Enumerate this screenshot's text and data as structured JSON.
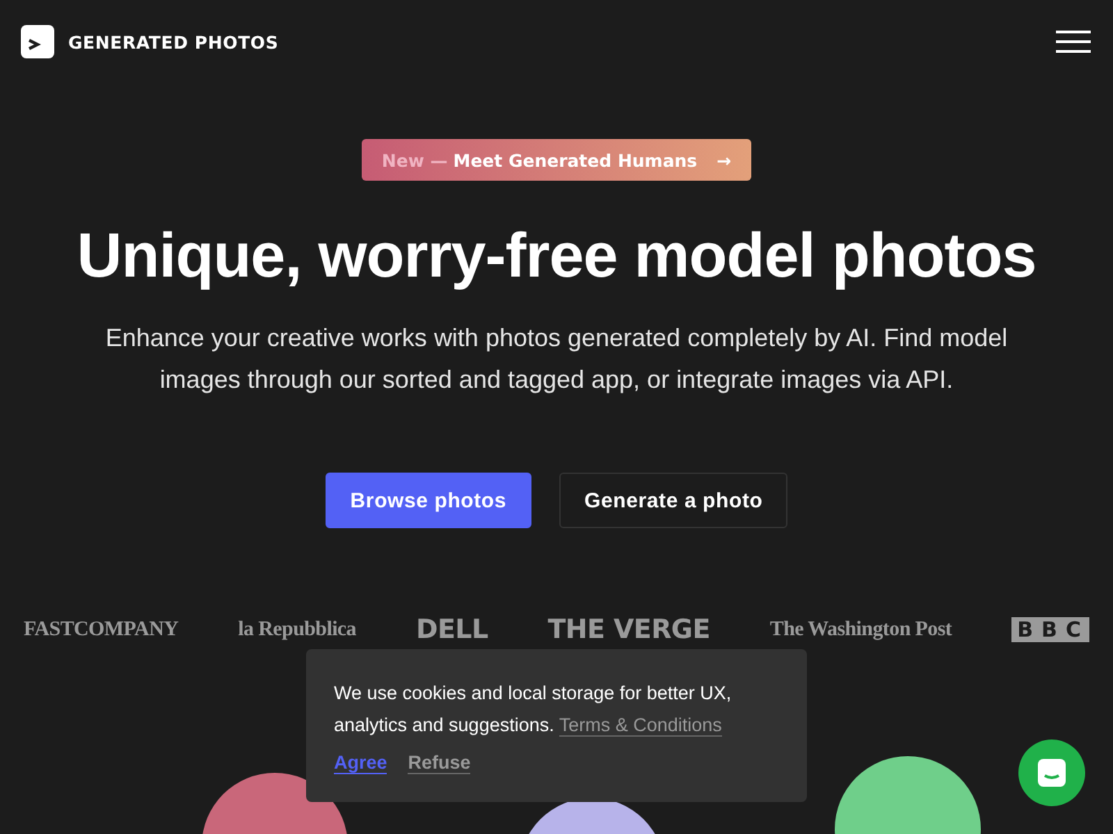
{
  "header": {
    "brand": "GENERATED PHOTOS"
  },
  "announcement": {
    "tag": "New —",
    "text": "Meet Generated Humans",
    "arrow": "→"
  },
  "hero": {
    "title": "Unique, worry-free model photos",
    "subtitle": "Enhance your creative works with photos generated completely by AI. Find model images through our sorted and tagged app, or integrate images via API."
  },
  "buttons": [
    {
      "label": "Browse photos",
      "kind": "primary"
    },
    {
      "label": "Generate a photo",
      "kind": "secondary"
    }
  ],
  "press": [
    {
      "name": "FASTCOMPANY",
      "kind": "serif"
    },
    {
      "name": "la Repubblica",
      "kind": "serif"
    },
    {
      "name": "DELL",
      "kind": "sans"
    },
    {
      "name": "THE VERGE",
      "kind": "sans"
    },
    {
      "name": "The Washington Post",
      "kind": "serif"
    },
    {
      "name": "BBC",
      "kind": "boxed"
    }
  ],
  "avatars": [
    {
      "color": "#c9677a"
    },
    {
      "color": "#b7b3ea"
    },
    {
      "color": "#6fcf8a"
    }
  ],
  "cookie": {
    "text": "We use cookies and local storage for better UX, analytics and suggestions.",
    "link": "Terms & Conditions",
    "agree": "Agree",
    "refuse": "Refuse"
  }
}
